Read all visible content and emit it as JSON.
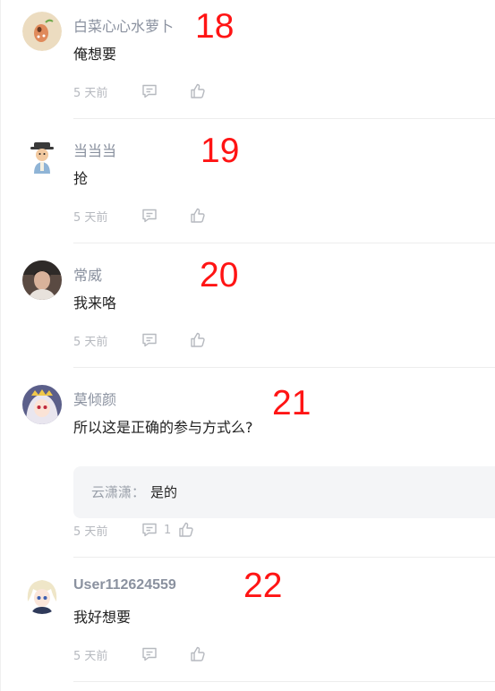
{
  "comments": [
    {
      "username": "白菜心心水萝卜",
      "content": "俺想要",
      "time": "5 天前",
      "annotation": "18",
      "avatar": "avatar-cartoon-bean"
    },
    {
      "username": "当当当",
      "content": "抢",
      "time": "5 天前",
      "annotation": "19",
      "avatar": "avatar-cartoon-man-hat"
    },
    {
      "username": "常威",
      "content": "我来咯",
      "time": "5 天前",
      "annotation": "20",
      "avatar": "avatar-photo-person"
    },
    {
      "username": "莫倾颜",
      "content": "所以这是正确的参与方式么?",
      "time": "5 天前",
      "annotation": "21",
      "avatar": "avatar-anime-girl",
      "reply_count": "1",
      "reply": {
        "username": "云潇潇：",
        "content": "是的"
      }
    },
    {
      "username": "User112624559",
      "content": "我好想要",
      "time": "5 天前",
      "annotation": "22",
      "avatar": "avatar-anime-boy"
    }
  ],
  "icons": {
    "reply": "comment-icon",
    "like": "thumbs-up-icon"
  },
  "colors": {
    "annotation": "#ff1414",
    "username": "#8a919f",
    "meta": "#b6b9bf",
    "reply_bg": "#f4f5f7"
  }
}
